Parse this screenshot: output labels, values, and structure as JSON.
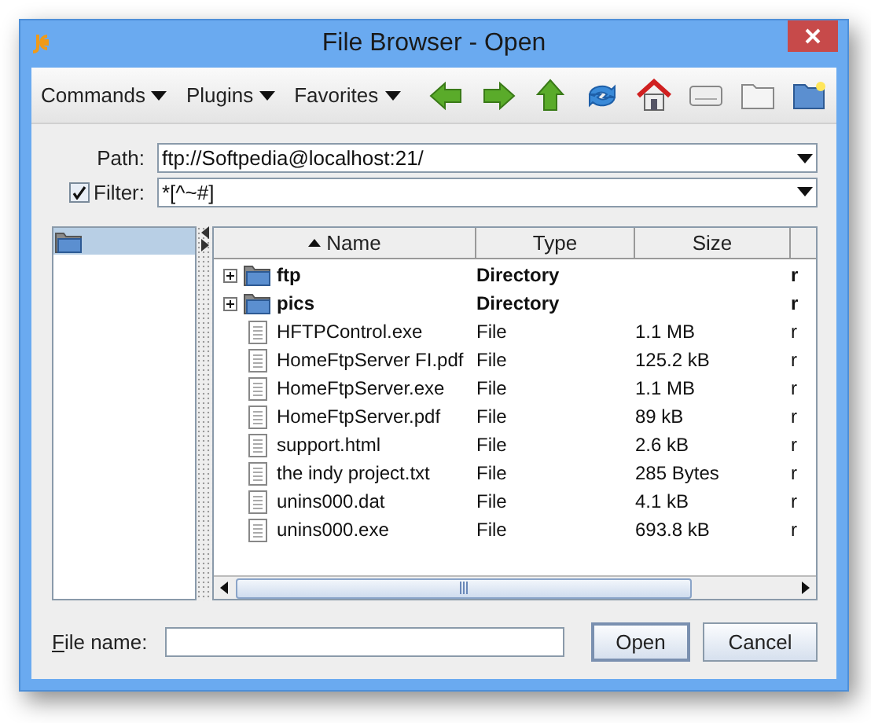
{
  "window": {
    "title": "File Browser - Open"
  },
  "menus": [
    {
      "label": "Commands"
    },
    {
      "label": "Plugins"
    },
    {
      "label": "Favorites"
    }
  ],
  "path": {
    "label": "Path:",
    "value": "ftp://Softpedia@localhost:21/"
  },
  "filter": {
    "label": "Filter:",
    "checked": true,
    "value": "*[^~#]"
  },
  "tree": {
    "items": [
      {
        "selected": true
      }
    ]
  },
  "table": {
    "columns": [
      {
        "label": "Name",
        "sorted": true
      },
      {
        "label": "Type",
        "sorted": false
      },
      {
        "label": "Size",
        "sorted": false
      }
    ],
    "rows": [
      {
        "kind": "directory",
        "name": "ftp",
        "type": "Directory",
        "column_4": "r"
      },
      {
        "kind": "directory",
        "name": "pics",
        "type": "Directory",
        "column_4": "r"
      },
      {
        "kind": "file",
        "name": "HFTPControl.exe",
        "type": "File",
        "size": "1.1 MB",
        "column_4": "r"
      },
      {
        "kind": "file",
        "name": "HomeFtpServer FI.pdf",
        "type": "File",
        "size": "125.2 kB",
        "column_4": "r"
      },
      {
        "kind": "file",
        "name": "HomeFtpServer.exe",
        "type": "File",
        "size": "1.1 MB",
        "column_4": "r"
      },
      {
        "kind": "file",
        "name": "HomeFtpServer.pdf",
        "type": "File",
        "size": "89 kB",
        "column_4": "r"
      },
      {
        "kind": "file",
        "name": "support.html",
        "type": "File",
        "size": "2.6 kB",
        "column_4": "r"
      },
      {
        "kind": "file",
        "name": "the indy project.txt",
        "type": "File",
        "size": "285 Bytes",
        "column_4": "r"
      },
      {
        "kind": "file",
        "name": "unins000.dat",
        "type": "File",
        "size": "4.1 kB",
        "column_4": "r"
      },
      {
        "kind": "file",
        "name": "unins000.exe",
        "type": "File",
        "size": "693.8 kB",
        "column_4": "r"
      }
    ]
  },
  "file_name": {
    "label": "File name:"
  },
  "buttons": [
    {
      "label": "Open",
      "default": true
    },
    {
      "label": "Cancel",
      "default": false
    }
  ]
}
